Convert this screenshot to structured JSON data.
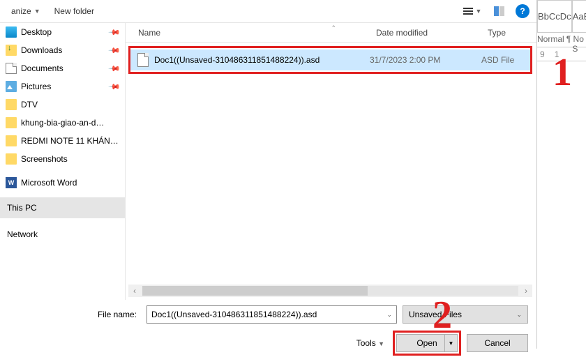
{
  "toolbar": {
    "organize": "anize",
    "new_folder": "New folder"
  },
  "columns": {
    "name": "Name",
    "date": "Date modified",
    "type": "Type"
  },
  "sidebar": {
    "quick": [
      {
        "label": "Desktop",
        "icon": "desktop",
        "pinned": true
      },
      {
        "label": "Downloads",
        "icon": "downloads",
        "pinned": true
      },
      {
        "label": "Documents",
        "icon": "doc",
        "pinned": true
      },
      {
        "label": "Pictures",
        "icon": "pic",
        "pinned": true
      },
      {
        "label": "DTV",
        "icon": "folder",
        "pinned": false
      },
      {
        "label": "khung-bia-giao-an-d…",
        "icon": "folder",
        "pinned": false
      },
      {
        "label": "REDMI NOTE 11 KHÁN…",
        "icon": "folder",
        "pinned": false
      },
      {
        "label": "Screenshots",
        "icon": "folder",
        "pinned": false
      }
    ],
    "word": "Microsoft Word",
    "thispc": "This PC",
    "network": "Network"
  },
  "file": {
    "name": "Doc1((Unsaved-310486311851488224)).asd",
    "date": "31/7/2023 2:00 PM",
    "type": "ASD File"
  },
  "bottom": {
    "file_name_label": "File name:",
    "file_name_value": "Doc1((Unsaved-310486311851488224)).asd",
    "filter": "Unsaved Files",
    "tools": "Tools",
    "open": "Open",
    "cancel": "Cancel"
  },
  "word_bg": {
    "style1": "BbCcDc",
    "style2": "AaBb",
    "label1": "Normal",
    "label2": "¶ No S",
    "ruler": [
      "9",
      "1"
    ]
  },
  "annotations": {
    "one": "1",
    "two": "2"
  }
}
